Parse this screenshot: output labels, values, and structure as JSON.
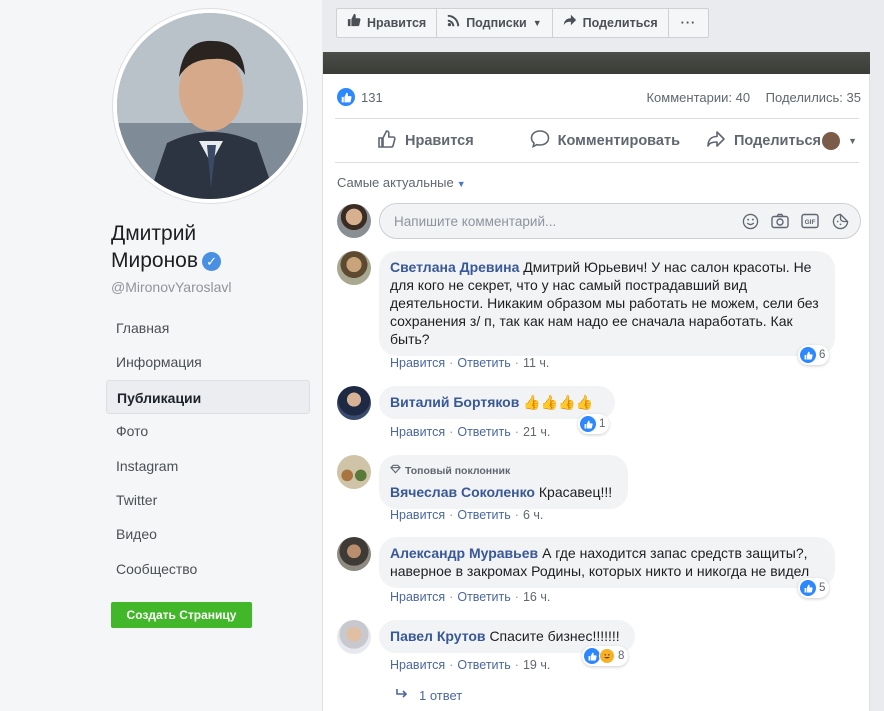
{
  "page": {
    "name": "Дмитрий\nМиронов",
    "name_line1": "Дмитрий",
    "name_line2": "Миронов",
    "handle": "@MironovYaroslavl",
    "create_page_label": "Создать Страницу"
  },
  "nav": {
    "items": [
      {
        "label": "Главная",
        "active": false
      },
      {
        "label": "Информация",
        "active": false
      },
      {
        "label": "Публикации",
        "active": true
      },
      {
        "label": "Фото",
        "active": false
      },
      {
        "label": "Instagram",
        "active": false
      },
      {
        "label": "Twitter",
        "active": false
      },
      {
        "label": "Видео",
        "active": false
      },
      {
        "label": "Сообщество",
        "active": false
      }
    ]
  },
  "topbar": {
    "like_label": "Нравится",
    "follow_label": "Подписки",
    "share_label": "Поделиться",
    "more_label": "···"
  },
  "post": {
    "like_count": "131",
    "comments_label": "Комментарии: 40",
    "shares_label": "Поделились: 35",
    "action_like": "Нравится",
    "action_comment": "Комментировать",
    "action_share": "Поделиться",
    "sort_label": "Самые актуальные",
    "comment_placeholder": "Напишите комментарий..."
  },
  "comments": [
    {
      "author": "Светлана Древина",
      "text": "Дмитрий Юрьевич! У нас салон красоты. Не для кого не секрет, что у нас самый пострадавший вид деятельности. Никаким образом мы работать не можем, сели без сохранения з/ п, так как нам надо ее сначала наработать. Как быть?",
      "like": "Нравится",
      "reply": "Ответить",
      "time": "11 ч.",
      "reactions": "6",
      "fan_badge": ""
    },
    {
      "author": "Виталий Бортяков",
      "text": "👍👍👍👍",
      "like": "Нравится",
      "reply": "Ответить",
      "time": "21 ч.",
      "reactions": "1",
      "fan_badge": ""
    },
    {
      "author": "Вячеслав Соколенко",
      "text": "Красавец!!!",
      "like": "Нравится",
      "reply": "Ответить",
      "time": "6 ч.",
      "reactions": "",
      "fan_badge": "Топовый поклонник"
    },
    {
      "author": "Александр Муравьев",
      "text": "А где находится запас средств защиты?, наверное в закромах Родины, которых никто и никогда не видел",
      "like": "Нравится",
      "reply": "Ответить",
      "time": "16 ч.",
      "reactions": "5",
      "fan_badge": ""
    },
    {
      "author": "Павел Крутов",
      "text": "Спасите бизнес!!!!!!!",
      "like": "Нравится",
      "reply": "Ответить",
      "time": "19 ч.",
      "reactions": "8",
      "fan_badge": ""
    }
  ],
  "replies": {
    "label": "1 ответ"
  },
  "colors": {
    "accent": "#385898",
    "like_blue": "#2d88ff",
    "create_green": "#42b72a"
  }
}
